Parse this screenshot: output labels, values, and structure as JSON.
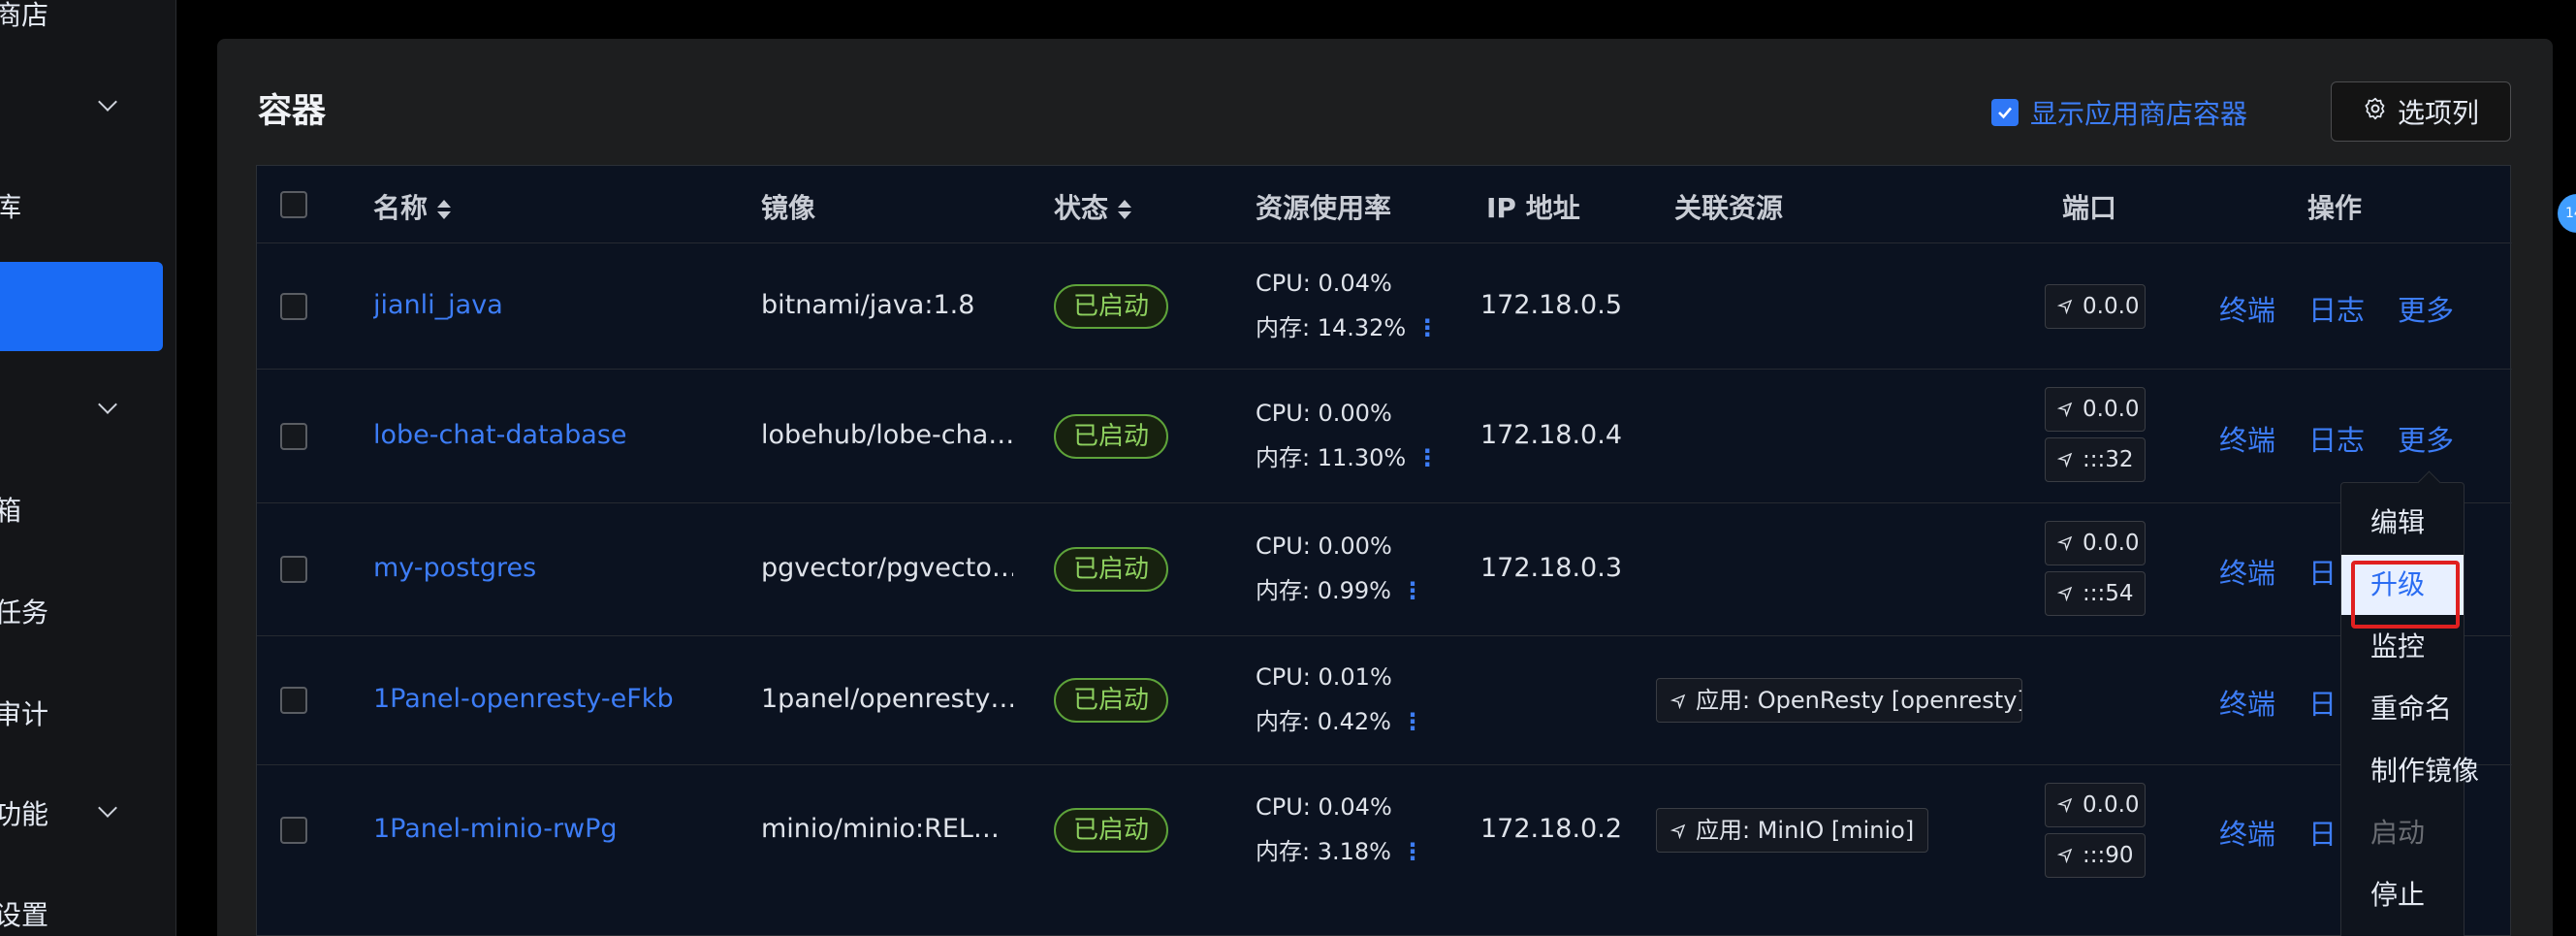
{
  "sidebar": {
    "items": [
      {
        "label": "商店"
      },
      {
        "label": ""
      },
      {
        "label": "库"
      },
      {
        "label": ""
      },
      {
        "label": ""
      },
      {
        "label": "箱"
      },
      {
        "label": "任务"
      },
      {
        "label": "审计"
      },
      {
        "label": "功能"
      },
      {
        "label": "设置"
      }
    ]
  },
  "panel": {
    "title": "容器",
    "show_app_label": "显示应用商店容器",
    "show_app_checked": true,
    "columns_button": "选项列"
  },
  "table": {
    "headers": {
      "name": "名称",
      "image": "镜像",
      "status": "状态",
      "usage": "资源使用率",
      "ip": "IP 地址",
      "related": "关联资源",
      "port": "端口",
      "actions": "操作"
    },
    "rows": [
      {
        "name": "jianli_java",
        "image": "bitnami/java:1.8",
        "status": "已启动",
        "cpu": "CPU: 0.04%",
        "mem": "内存: 14.32%",
        "ip": "172.18.0.5",
        "related": "",
        "ports": [
          "0.0.0"
        ],
        "actions": [
          "终端",
          "日志",
          "更多"
        ]
      },
      {
        "name": "lobe-chat-database",
        "image": "lobehub/lobe-cha…",
        "status": "已启动",
        "cpu": "CPU: 0.00%",
        "mem": "内存: 11.30%",
        "ip": "172.18.0.4",
        "related": "",
        "ports": [
          "0.0.0",
          ":::32"
        ],
        "actions": [
          "终端",
          "日志",
          "更多"
        ]
      },
      {
        "name": "my-postgres",
        "image": "pgvector/pgvecto…",
        "status": "已启动",
        "cpu": "CPU: 0.00%",
        "mem": "内存: 0.99%",
        "ip": "172.18.0.3",
        "related": "",
        "ports": [
          "0.0.0",
          ":::54"
        ],
        "actions": [
          "终端",
          "日"
        ]
      },
      {
        "name": "1Panel-openresty-eFkb",
        "image": "1panel/openresty…",
        "status": "已启动",
        "cpu": "CPU: 0.01%",
        "mem": "内存: 0.42%",
        "ip": "",
        "related": "应用: OpenResty [openresty]",
        "ports": [],
        "actions": [
          "终端",
          "日"
        ]
      },
      {
        "name": "1Panel-minio-rwPg",
        "image": "minio/minio:REL…",
        "status": "已启动",
        "cpu": "CPU: 0.04%",
        "mem": "内存: 3.18%",
        "ip": "172.18.0.2",
        "related": "应用: MinIO [minio]",
        "ports": [
          "0.0.0",
          ":::90"
        ],
        "actions": [
          "终端",
          "日"
        ]
      }
    ]
  },
  "more_menu": {
    "items": [
      {
        "label": "编辑",
        "state": "normal"
      },
      {
        "label": "升级",
        "state": "highlighted"
      },
      {
        "label": "监控",
        "state": "normal"
      },
      {
        "label": "重命名",
        "state": "normal"
      },
      {
        "label": "制作镜像",
        "state": "normal"
      },
      {
        "label": "启动",
        "state": "disabled"
      },
      {
        "label": "停止",
        "state": "normal"
      }
    ]
  },
  "edge_badge": "14",
  "colors": {
    "accent": "#3d7df7",
    "status_running": "#8ed05f",
    "highlight_box": "#e02020",
    "sidebar_active": "#1a6bf5"
  }
}
